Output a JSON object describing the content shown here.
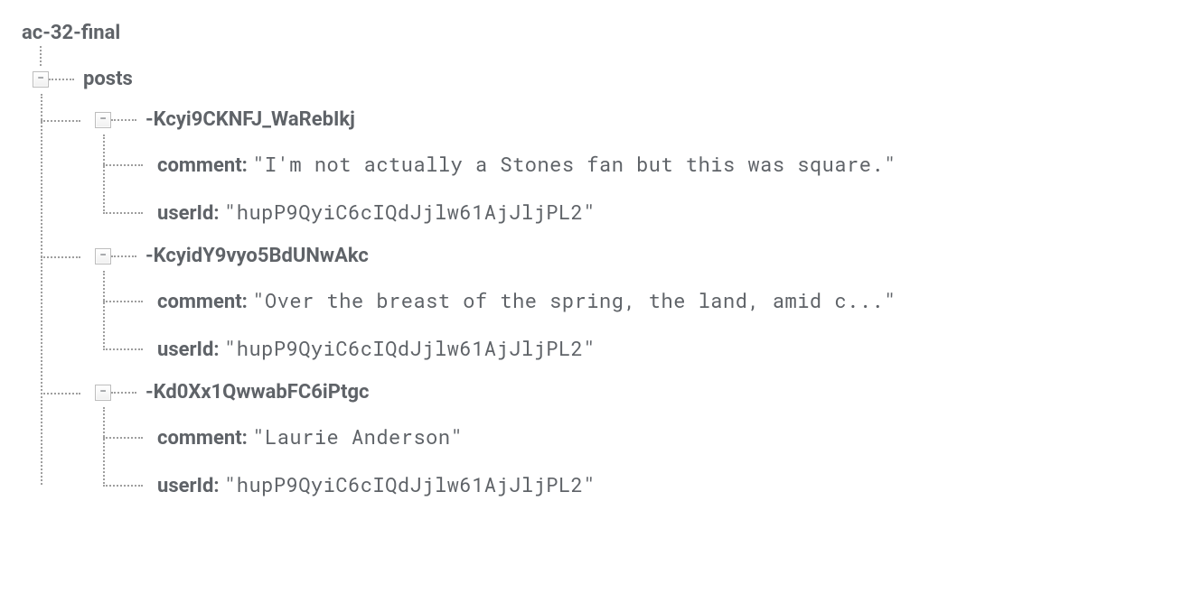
{
  "root": {
    "label": "ac-32-final"
  },
  "posts": {
    "label": "posts",
    "items": [
      {
        "id": "-Kcyi9CKNFJ_WaRebIkj",
        "comment_key": "comment:",
        "comment_val": "\"I'm not actually a Stones fan but this was square.\"",
        "userId_key": "userId:",
        "userId_val": "\"hupP9QyiC6cIQdJjlw61AjJljPL2\""
      },
      {
        "id": "-KcyidY9vyo5BdUNwAkc",
        "comment_key": "comment:",
        "comment_val": "\"Over the breast of the spring, the land, amid c...\"",
        "userId_key": "userId:",
        "userId_val": "\"hupP9QyiC6cIQdJjlw61AjJljPL2\""
      },
      {
        "id": "-Kd0Xx1QwwabFC6iPtgc",
        "comment_key": "comment:",
        "comment_val": "\"Laurie Anderson\"",
        "userId_key": "userId:",
        "userId_val": "\"hupP9QyiC6cIQdJjlw61AjJljPL2\""
      }
    ]
  }
}
